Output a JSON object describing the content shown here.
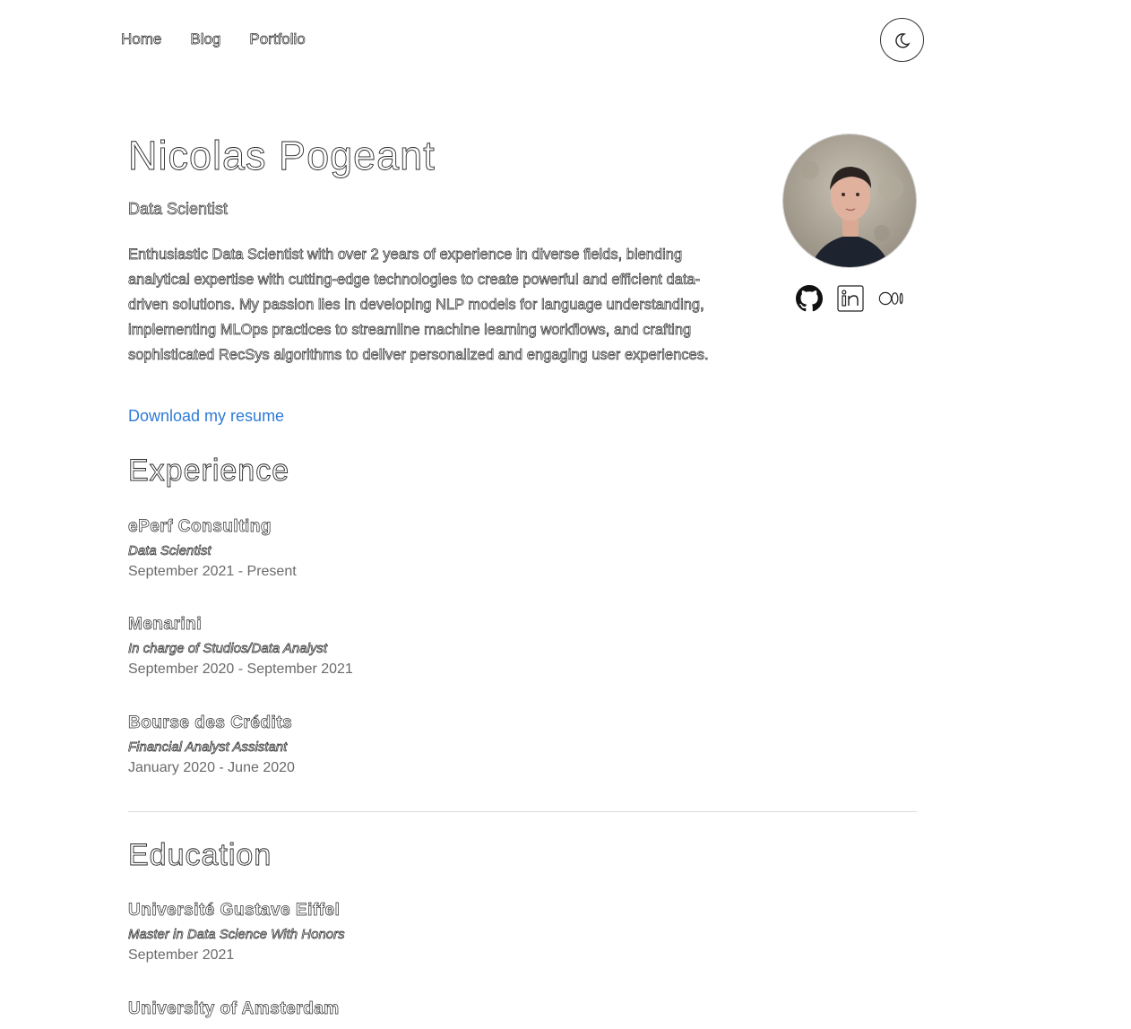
{
  "nav": {
    "items": [
      {
        "label": "Home"
      },
      {
        "label": "Blog"
      },
      {
        "label": "Portfolio"
      }
    ]
  },
  "theme_toggle": {
    "icon": "moon-icon"
  },
  "profile": {
    "name": "Nicolas Pogeant",
    "role": "Data Scientist",
    "bio": "Enthusiastic Data Scientist with over 2 years of experience in diverse fields, blending analytical expertise with cutting-edge technologies to create powerful and efficient data-driven solutions. My passion lies in developing NLP models for language understanding, implementing MLOps practices to streamline machine learning workflows, and crafting sophisticated RecSys algorithms to deliver personalized and engaging user experiences.",
    "resume_link": "Download my resume",
    "socials": [
      {
        "icon": "github-icon"
      },
      {
        "icon": "linkedin-icon"
      },
      {
        "icon": "medium-icon"
      }
    ]
  },
  "experience": {
    "title": "Experience",
    "items": [
      {
        "org": "ePerf Consulting",
        "position": "Data Scientist",
        "dates": "September 2021 - Present"
      },
      {
        "org": "Menarini",
        "position": "In charge of Studios/Data Analyst",
        "dates": "September 2020 - September 2021"
      },
      {
        "org": "Bourse des Crédits",
        "position": "Financial Analyst Assistant",
        "dates": "January 2020 - June 2020"
      }
    ]
  },
  "education": {
    "title": "Education",
    "items": [
      {
        "org": "Université Gustave Eiffel",
        "position": "Master in Data Science With Honors",
        "dates": "September 2021"
      },
      {
        "org": "University of Amsterdam",
        "position": "",
        "dates": ""
      }
    ]
  },
  "colors": {
    "link": "#2f7bd6",
    "divider": "#dcdcdc",
    "date": "#6a6a6a"
  }
}
